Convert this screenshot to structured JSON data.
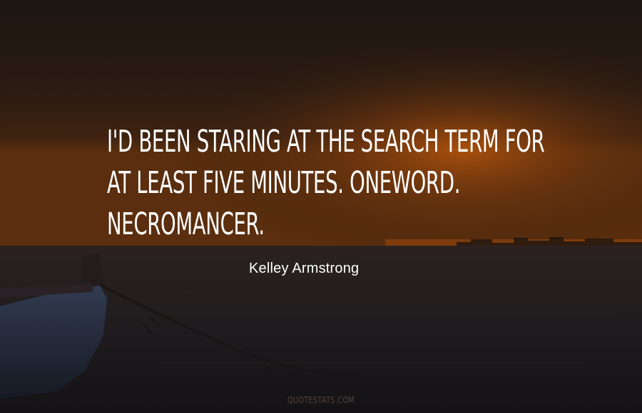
{
  "quote": {
    "lines": [
      "I'D BEEN STARING AT THE SEARCH TERM FOR",
      "AT LEAST FIVE MINUTES. ONEWORD.",
      "NECROMANCER."
    ]
  },
  "author": "Kelley Armstrong",
  "watermark": "QUOTESTATS.COM",
  "colors": {
    "text": "#ffffff",
    "sky_top": "#1c1712",
    "sky_glow": "#c8620f",
    "water": "#1d1a1c"
  }
}
